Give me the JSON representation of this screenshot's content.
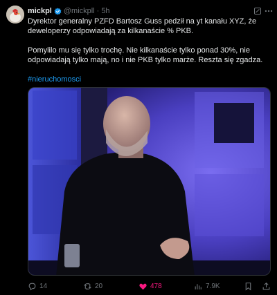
{
  "author": {
    "name": "mickpl",
    "handle": "@mickpll",
    "separator": "·",
    "time": "5h"
  },
  "tweet": {
    "para1": "Dyrektor generalny PZFD Bartosz Guss pedził na yt kanału XYZ, że deweloperzy odpowiadają za kilkanaście % PKB.",
    "para2": "Pomylilo mu się tylko trochę. Nie kilkanaście tylko ponad 30%, nie odpowiadają tylko mają, no i nie PKB tylko marże. Reszta się zgadza.",
    "hashtag": "#nieruchomosci"
  },
  "actions": {
    "replies": "14",
    "reposts": "20",
    "likes": "478",
    "views": "7.9K"
  },
  "colors": {
    "background": "#000000",
    "text": "#e7e9ea",
    "muted": "#71767b",
    "link": "#1d9bf0",
    "like": "#f91880"
  },
  "icons": [
    "verified-badge-icon",
    "grok-icon",
    "more-icon",
    "reply-icon",
    "repost-icon",
    "like-icon",
    "views-icon",
    "bookmark-icon"
  ]
}
